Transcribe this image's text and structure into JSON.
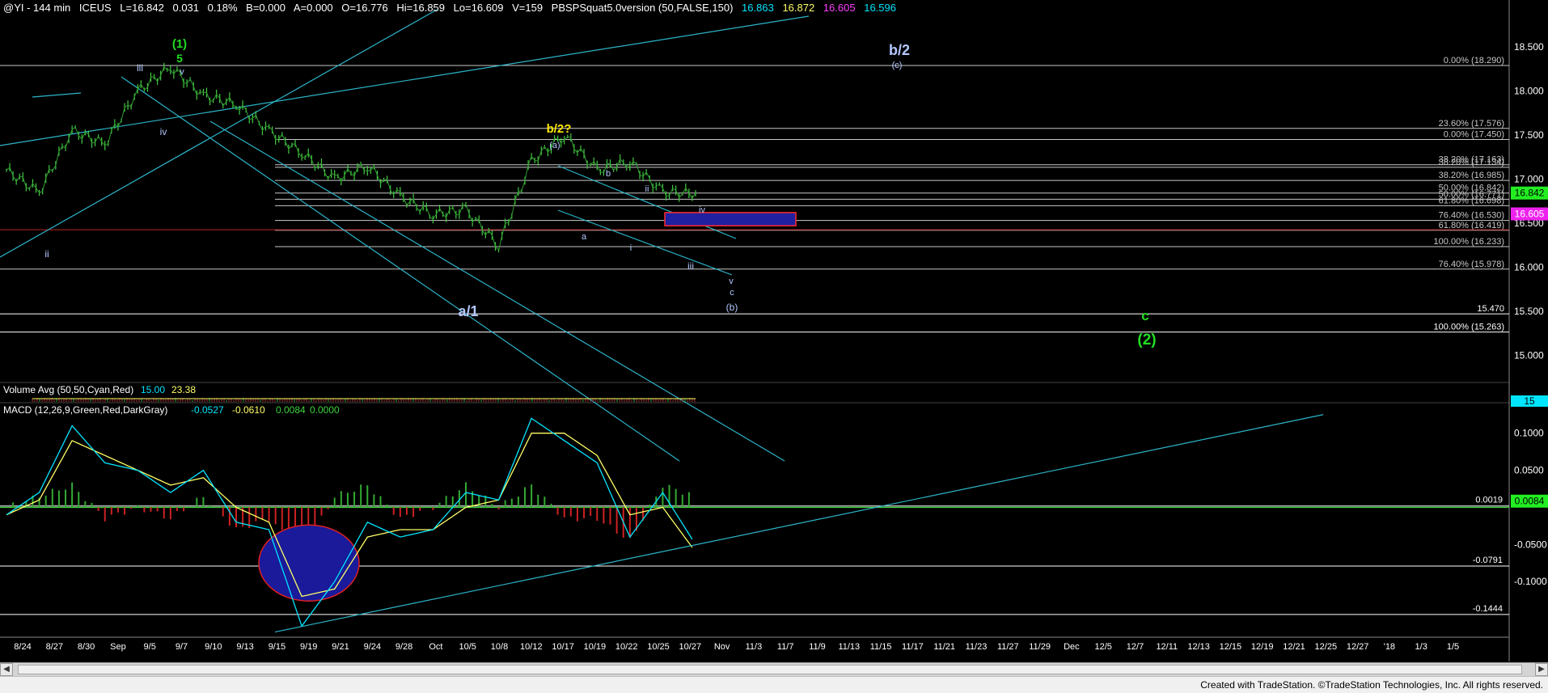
{
  "header": {
    "symbol": "@YI - 144 min",
    "exchange": "ICEUS",
    "last": "L=16.842",
    "change": "0.031",
    "change_pct": "0.18%",
    "bid": "B=0.000",
    "ask": "A=0.000",
    "open": "O=16.776",
    "high": "Hi=16.859",
    "low": "Lo=16.609",
    "volume": "V=159",
    "indicator": "PBSPSquat5.0version (50,FALSE,150)",
    "ind_values": [
      "16.863",
      "16.872",
      "16.605",
      "16.596"
    ],
    "ind_colors": [
      "#00e5ff",
      "#ffff66",
      "#ff3fff",
      "#00e5ff"
    ]
  },
  "colors": {
    "background": "#000000",
    "price": "#44cc44",
    "channel": "#2bb5c9",
    "fib_line": "#c8c8c8",
    "wave_green": "#22dd22",
    "wave_yellow": "#ffe600",
    "wave_blue": "#b4c8ff",
    "macd": "#00e5ff",
    "signal": "#ffff66",
    "hist_pos": "#33aa33",
    "hist_neg": "#cc2222",
    "target_box": "#2020a0",
    "target_border": "#ff2a2a"
  },
  "chart_data": [
    {
      "type": "line",
      "x": [
        "8/24",
        "8/27",
        "8/30",
        "Sep",
        "9/5",
        "9/7",
        "9/10",
        "9/13",
        "9/15",
        "9/19",
        "9/21",
        "9/24",
        "9/28",
        "Oct",
        "10/5",
        "10/8",
        "10/12",
        "10/17",
        "10/19",
        "10/22",
        "10/25",
        "10/27"
      ],
      "series": [
        {
          "values": [
            17.1,
            16.85,
            17.55,
            17.4,
            18.0,
            18.27,
            17.95,
            17.85,
            17.55,
            17.3,
            17.0,
            17.15,
            16.8,
            16.6,
            16.65,
            16.25,
            17.2,
            17.5,
            17.1,
            17.2,
            16.85,
            16.84
          ]
        }
      ],
      "ylim": [
        14.7,
        18.85
      ],
      "y_ticks": [
        "18.500",
        "18.000",
        "17.500",
        "17.000",
        "16.500",
        "16.000",
        "15.500",
        "15.000"
      ],
      "x_ticks": [
        "8/24",
        "8/27",
        "8/30",
        "Sep",
        "9/5",
        "9/7",
        "9/10",
        "9/13",
        "9/15",
        "9/19",
        "9/21",
        "9/24",
        "9/28",
        "Oct",
        "10/5",
        "10/8",
        "10/12",
        "10/17",
        "10/19",
        "10/22",
        "10/25",
        "10/27",
        "Nov",
        "11/3",
        "11/7",
        "11/9",
        "11/13",
        "11/15",
        "11/17",
        "11/21",
        "11/23",
        "11/27",
        "11/29",
        "Dec",
        "12/5",
        "12/7",
        "12/11",
        "12/13",
        "12/15",
        "12/19",
        "12/21",
        "12/25",
        "12/27",
        "'18",
        "1/3",
        "1/5"
      ],
      "price_flags": [
        {
          "label": "16.842",
          "value": 16.842,
          "color": "#22ee22",
          "text_color": "#000000"
        },
        {
          "label": "16.605",
          "value": 16.605,
          "color": "#ee22ee",
          "text_color": "#ffffff"
        }
      ],
      "fib_levels": [
        {
          "label": "0.00% (18.290)",
          "value": 18.29
        },
        {
          "label": "23.60% (17.576)",
          "value": 17.576
        },
        {
          "label": "0.00% (17.450)",
          "value": 17.45
        },
        {
          "label": "38.20% (17.163)",
          "value": 17.163
        },
        {
          "label": "38.20% (17.134)",
          "value": 17.134
        },
        {
          "label": "38.20% (16.985)",
          "value": 16.985
        },
        {
          "label": "50.00% (16.842)",
          "value": 16.842
        },
        {
          "label": "50.00% (16.771)",
          "value": 16.771
        },
        {
          "label": "61.80% (16.698)",
          "value": 16.698
        },
        {
          "label": "76.40% (16.530)",
          "value": 16.53
        },
        {
          "label": "61.80% (16.419)",
          "value": 16.419
        },
        {
          "label": "100.00% (16.233)",
          "value": 16.233
        },
        {
          "label": "76.40% (15.978)",
          "value": 15.978
        },
        {
          "label": "15.470",
          "value": 15.47
        },
        {
          "label": "100.00% (15.263)",
          "value": 15.263
        }
      ],
      "wave_labels": [
        {
          "text": "(1)",
          "color": "#22dd22"
        },
        {
          "text": "5",
          "color": "#22dd22"
        },
        {
          "text": "iii",
          "color": "#b4c8ff"
        },
        {
          "text": "v",
          "color": "#b4c8ff"
        },
        {
          "text": "iv",
          "color": "#b4c8ff"
        },
        {
          "text": "ii",
          "color": "#b4c8ff"
        },
        {
          "text": "b/2?",
          "color": "#ffe600"
        },
        {
          "text": "(a)",
          "color": "#b4c8ff"
        },
        {
          "text": "b",
          "color": "#b4c8ff"
        },
        {
          "text": "ii",
          "color": "#b4c8ff"
        },
        {
          "text": "iv",
          "color": "#b4c8ff"
        },
        {
          "text": "a",
          "color": "#b4c8ff"
        },
        {
          "text": "i",
          "color": "#b4c8ff"
        },
        {
          "text": "iii",
          "color": "#b4c8ff"
        },
        {
          "text": "v",
          "color": "#b4c8ff"
        },
        {
          "text": "c",
          "color": "#b4c8ff"
        },
        {
          "text": "(b)",
          "color": "#b4c8ff"
        },
        {
          "text": "a/1",
          "color": "#b4c8ff"
        },
        {
          "text": "b/2",
          "color": "#b4c8ff"
        },
        {
          "text": "(c)",
          "color": "#b4c8ff"
        },
        {
          "text": "c",
          "color": "#22dd22"
        },
        {
          "text": "(2)",
          "color": "#22dd22"
        }
      ]
    },
    {
      "type": "bar",
      "title": "Volume Avg (50,50,Cyan,Red)",
      "legend_values": [
        "15.00",
        "23.38"
      ],
      "legend_colors": [
        "#00e5ff",
        "#ffff66"
      ],
      "axis_flag": "15"
    },
    {
      "type": "line",
      "title": "MACD (12,26,9,Green,Red,DarkGray)",
      "legend_values": [
        "-0.0527",
        "-0.0610",
        "0.0084",
        "0.0000"
      ],
      "legend_colors": [
        "#00e5ff",
        "#ffff66",
        "#3cd23c",
        "#3cd23c"
      ],
      "series": [
        {
          "values": [
            -0.01,
            0.02,
            0.11,
            0.06,
            0.05,
            0.02,
            0.05,
            -0.02,
            -0.03,
            -0.16,
            -0.1,
            -0.02,
            -0.04,
            -0.03,
            0.02,
            0.01,
            0.12,
            0.09,
            0.06,
            -0.04,
            0.02,
            -0.05
          ]
        },
        {
          "values": [
            -0.01,
            0.01,
            0.09,
            0.07,
            0.05,
            0.03,
            0.04,
            0.0,
            -0.02,
            -0.12,
            -0.11,
            -0.04,
            -0.03,
            -0.03,
            0.0,
            0.01,
            0.1,
            0.1,
            0.07,
            -0.01,
            0.0,
            -0.06
          ]
        }
      ],
      "ylim": [
        -0.175,
        0.14
      ],
      "y_ticks": [
        "0.1000",
        "0.0500",
        "-0.0500",
        "-0.1000"
      ],
      "levels": [
        {
          "label": "0.0019",
          "value": 0.0019
        },
        {
          "label": "-0.0791",
          "value": -0.0791
        },
        {
          "label": "-0.1444",
          "value": -0.1444
        }
      ],
      "axis_flag": "0.0084"
    }
  ],
  "footer": {
    "credit": "Created with TradeStation. ©TradeStation Technologies, Inc. All rights reserved."
  }
}
